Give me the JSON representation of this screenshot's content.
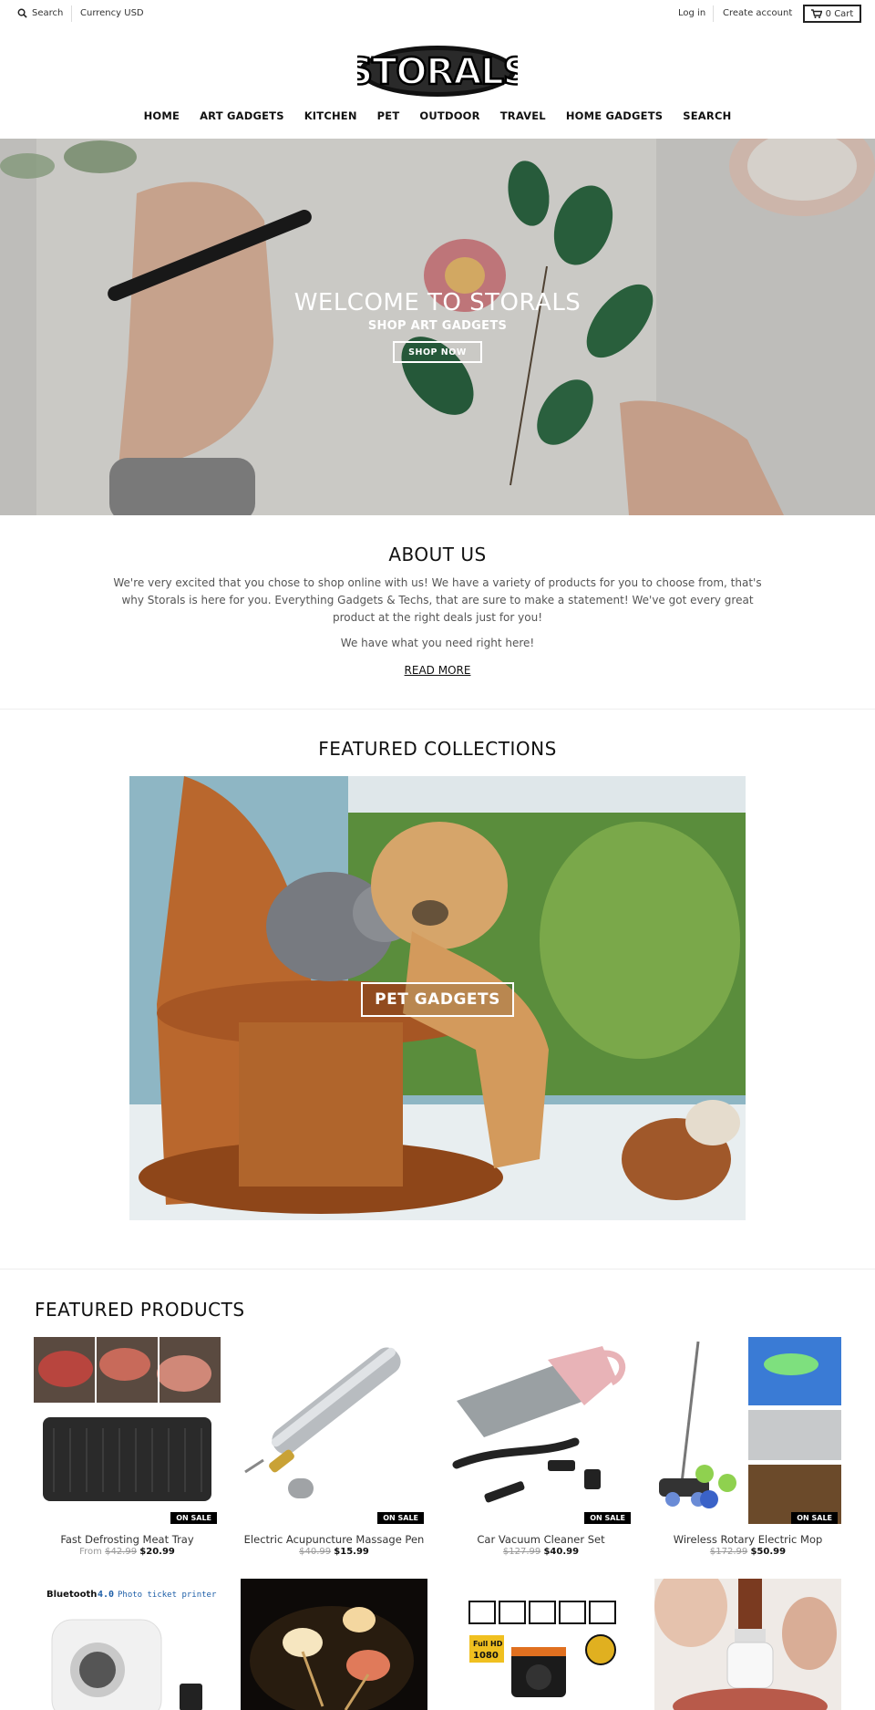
{
  "topbar": {
    "search_label": "Search",
    "currency_label": "Currency",
    "currency_value": "USD",
    "login_label": "Log in",
    "create_account_label": "Create account",
    "cart_label": "0 Cart"
  },
  "logo": {
    "text": "STORALS"
  },
  "nav": {
    "items": [
      "HOME",
      "ART GADGETS",
      "KITCHEN",
      "PET",
      "OUTDOOR",
      "TRAVEL",
      "HOME GADGETS",
      "SEARCH"
    ]
  },
  "hero": {
    "title": "WELCOME TO STORALS",
    "subtitle": "SHOP ART GADGETS",
    "button": "SHOP NOW"
  },
  "about": {
    "title": "ABOUT US",
    "text": "We're very excited that you chose to shop online with us! We have a variety of products for you to choose from, that's why Storals is here for you. Everything Gadgets & Techs, that are sure to make a statement! We've got every great product at the right deals just for you!",
    "text2": "We have what you need right here!",
    "read_more": "READ MORE"
  },
  "collections": {
    "title": "FEATURED COLLECTIONS",
    "items": [
      {
        "label": "PET GADGETS"
      }
    ]
  },
  "products": {
    "title": "FEATURED PRODUCTS",
    "sale_badge": "ON SALE",
    "items": [
      {
        "name": "Fast Defrosting Meat Tray",
        "prefix": "From",
        "old_price": "$42.99",
        "price": "$20.99"
      },
      {
        "name": "Electric Acupuncture Massage Pen",
        "prefix": "",
        "old_price": "$40.99",
        "price": "$15.99"
      },
      {
        "name": "Car Vacuum Cleaner Set",
        "prefix": "",
        "old_price": "$127.99",
        "price": "$40.99"
      },
      {
        "name": "Wireless Rotary Electric Mop",
        "prefix": "",
        "old_price": "$172.99",
        "price": "$50.99"
      }
    ],
    "row2_labels": {
      "printer_brand": "Bluetooth",
      "printer_version": "4.0",
      "printer_caption": "Photo ticket printer",
      "camera_label_1": "Full HD",
      "camera_label_2": "1080"
    }
  },
  "colors": {
    "accent": "#000000",
    "text": "#222222",
    "muted": "#555555"
  }
}
